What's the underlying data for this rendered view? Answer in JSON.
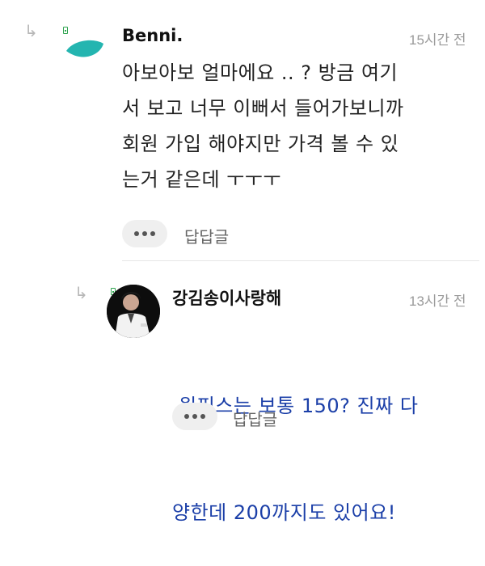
{
  "comments": [
    {
      "author": "Benni.",
      "time": "15시간 전",
      "text_lines": [
        "아보아보 얼마에요 .. ? 방금 여기",
        "서 보고 너무 이뻐서 들어가보니까",
        "회원 가입 해야지만 가격 볼 수 있",
        "는거 같은데 ㅜㅜㅜ"
      ],
      "reply_label": "답답글",
      "avatar_color": "#24b5b0"
    },
    {
      "author": "강김송이사랑해",
      "time": "13시간 전",
      "text_lines": [
        " 원피스는 보통 150? 진짜 다",
        "양한데 200까지도 있어요!"
      ],
      "reply_label": "답답글",
      "text_color": "#1b3fa8"
    }
  ],
  "icons": {
    "reply_arrow": "reply-arrow-icon",
    "level_badge": "level-badge-icon",
    "more": "more-options-icon"
  }
}
